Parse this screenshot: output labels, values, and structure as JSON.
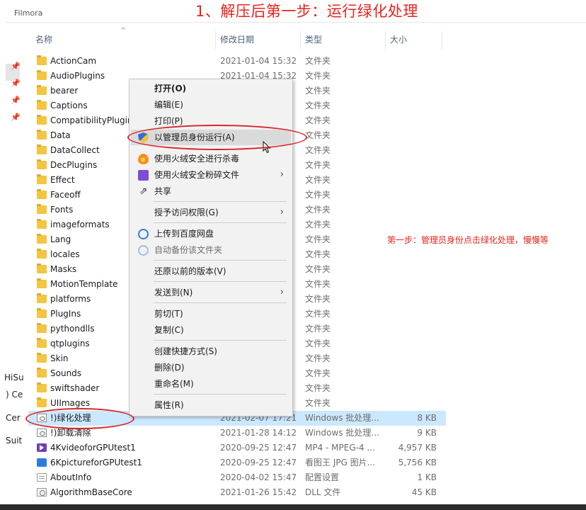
{
  "banner": {
    "title": "1、解压后第一步：运行绿化处理"
  },
  "window": {
    "cut_title": "Filmora"
  },
  "nav": {
    "labels": [
      "HiSu",
      ") Ce",
      "Cer",
      "Suit"
    ]
  },
  "columns": {
    "name": "名称",
    "date": "修改日期",
    "type": "类型",
    "size": "大小"
  },
  "files": [
    {
      "name": "ActionCam",
      "date": "2021-01-04 15:32",
      "type": "文件夹",
      "size": "",
      "icon": "folder-icon"
    },
    {
      "name": "AudioPlugins",
      "date": "2021-01-04 15:32",
      "type": "文件夹",
      "size": "",
      "icon": "folder-icon"
    },
    {
      "name": "bearer",
      "date": "",
      "type": "文件夹",
      "size": "",
      "icon": "folder-icon"
    },
    {
      "name": "Captions",
      "date": "",
      "type": "文件夹",
      "size": "",
      "icon": "folder-icon"
    },
    {
      "name": "CompatibilityPlugin",
      "date": "",
      "type": "文件夹",
      "size": "",
      "icon": "folder-icon"
    },
    {
      "name": "Data",
      "date": "",
      "type": "文件夹",
      "size": "",
      "icon": "folder-icon"
    },
    {
      "name": "DataCollect",
      "date": "",
      "type": "文件夹",
      "size": "",
      "icon": "folder-icon"
    },
    {
      "name": "DecPlugins",
      "date": "",
      "type": "文件夹",
      "size": "",
      "icon": "folder-icon"
    },
    {
      "name": "Effect",
      "date": "",
      "type": "文件夹",
      "size": "",
      "icon": "folder-icon"
    },
    {
      "name": "Faceoff",
      "date": "",
      "type": "文件夹",
      "size": "",
      "icon": "folder-icon"
    },
    {
      "name": "Fonts",
      "date": "",
      "type": "文件夹",
      "size": "",
      "icon": "folder-icon"
    },
    {
      "name": "imageformats",
      "date": "",
      "type": "文件夹",
      "size": "",
      "icon": "folder-icon"
    },
    {
      "name": "Lang",
      "date": "",
      "type": "文件夹",
      "size": "",
      "icon": "folder-icon"
    },
    {
      "name": "locales",
      "date": "",
      "type": "文件夹",
      "size": "",
      "icon": "folder-icon"
    },
    {
      "name": "Masks",
      "date": "",
      "type": "文件夹",
      "size": "",
      "icon": "folder-icon"
    },
    {
      "name": "MotionTemplate",
      "date": "",
      "type": "文件夹",
      "size": "",
      "icon": "folder-icon"
    },
    {
      "name": "platforms",
      "date": "",
      "type": "文件夹",
      "size": "",
      "icon": "folder-icon"
    },
    {
      "name": "PlugIns",
      "date": "",
      "type": "文件夹",
      "size": "",
      "icon": "folder-icon"
    },
    {
      "name": "pythondlls",
      "date": "",
      "type": "文件夹",
      "size": "",
      "icon": "folder-icon"
    },
    {
      "name": "qtplugins",
      "date": "",
      "type": "文件夹",
      "size": "",
      "icon": "folder-icon"
    },
    {
      "name": "Skin",
      "date": "",
      "type": "文件夹",
      "size": "",
      "icon": "folder-icon"
    },
    {
      "name": "Sounds",
      "date": "",
      "type": "文件夹",
      "size": "",
      "icon": "folder-icon"
    },
    {
      "name": "swiftshader",
      "date": "",
      "type": "文件夹",
      "size": "",
      "icon": "folder-icon"
    },
    {
      "name": "UIImages",
      "date": "",
      "type": "文件夹",
      "size": "",
      "icon": "folder-icon"
    },
    {
      "name": "!)绿化处理",
      "date": "2021-02-07 17:21",
      "type": "Windows 批处理...",
      "size": "8 KB",
      "icon": "bat-icon",
      "selected": true
    },
    {
      "name": "!)卸载清除",
      "date": "2021-01-28 14:12",
      "type": "Windows 批处理...",
      "size": "9 KB",
      "icon": "bat-icon"
    },
    {
      "name": "4KvideoforGPUtest1",
      "date": "2020-09-25 12:47",
      "type": "MP4 - MPEG-4 ...",
      "size": "4,957 KB",
      "icon": "mp4-icon"
    },
    {
      "name": "6KpictureforGPUtest1",
      "date": "2020-09-25 12:47",
      "type": "看图王 JPG 图片...",
      "size": "5,756 KB",
      "icon": "jpg-icon"
    },
    {
      "name": "AboutInfo",
      "date": "2020-04-02 15:47",
      "type": "配置设置",
      "size": "1 KB",
      "icon": "ini-icon"
    },
    {
      "name": "AlgorithmBaseCore",
      "date": "2021-01-26 15:42",
      "type": "DLL 文件",
      "size": "45 KB",
      "icon": "dll-icon"
    }
  ],
  "context_menu": {
    "open": "打开(O)",
    "edit": "编辑(E)",
    "print": "打印(P)",
    "run_as_admin": "以管理员身份运行(A)",
    "huorong_scan": "使用火绒安全进行杀毒",
    "huorong_shred": "使用火绒安全粉碎文件",
    "share": "共享",
    "grant_access": "授予访问权限(G)",
    "upload_baidu": "上传到百度网盘",
    "auto_backup": "自动备份该文件夹",
    "restore": "还原以前的版本(V)",
    "send_to": "发送到(N)",
    "cut": "剪切(T)",
    "copy": "复制(C)",
    "create_shortcut": "创建快捷方式(S)",
    "delete": "删除(D)",
    "rename": "重命名(M)",
    "properties": "属性(R)"
  },
  "annotation": {
    "note": "第一步：管理员身份点击绿化处理，慢慢等"
  },
  "colors": {
    "annotation_red": "#d8262b",
    "selection": "#cce8ff",
    "menu_bg": "#f2f2f2"
  }
}
